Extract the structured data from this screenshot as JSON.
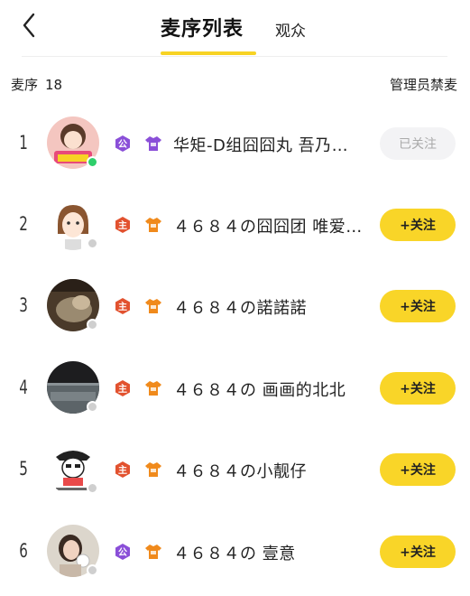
{
  "header": {
    "tab_active": "麦序列表",
    "tab_other": "观众"
  },
  "subbar": {
    "queue_label": "麦序",
    "queue_count": "18",
    "admin_mute": "管理员禁麦"
  },
  "colors": {
    "accent": "#f9d528",
    "badge_public": "#8a4fd8",
    "badge_host": "#e2522f",
    "badge_orange": "#f08a1c",
    "online": "#2ecf6b",
    "offline": "#cfcfcf"
  },
  "rows": [
    {
      "rank": "1",
      "name": "华矩-D组囧囧丸 吾乃…",
      "badge": "公",
      "badge_type": "public",
      "level_icon": "purple-shirt-icon",
      "status": "online",
      "button": "已关注",
      "followed": true
    },
    {
      "rank": "2",
      "name": "４６８４の囧囧团 唯爱…",
      "badge": "主",
      "badge_type": "host",
      "level_icon": "orange-shirt-icon",
      "status": "offline",
      "button": "+关注",
      "followed": false
    },
    {
      "rank": "3",
      "name": "４６８４の諾諾諾",
      "badge": "主",
      "badge_type": "host",
      "level_icon": "orange-shirt-icon",
      "status": "offline",
      "button": "+关注",
      "followed": false
    },
    {
      "rank": "4",
      "name": "４６８４の 画画的北北",
      "badge": "主",
      "badge_type": "host",
      "level_icon": "orange-shirt-icon",
      "status": "offline",
      "button": "+关注",
      "followed": false
    },
    {
      "rank": "5",
      "name": "４６８４の小靓仔",
      "badge": "主",
      "badge_type": "host",
      "level_icon": "orange-shirt-icon",
      "status": "offline",
      "button": "+关注",
      "followed": false
    },
    {
      "rank": "6",
      "name": "４６８４の 壹意",
      "badge": "公",
      "badge_type": "public",
      "level_icon": "orange-shirt-icon",
      "status": "offline",
      "button": "+关注",
      "followed": false
    }
  ]
}
